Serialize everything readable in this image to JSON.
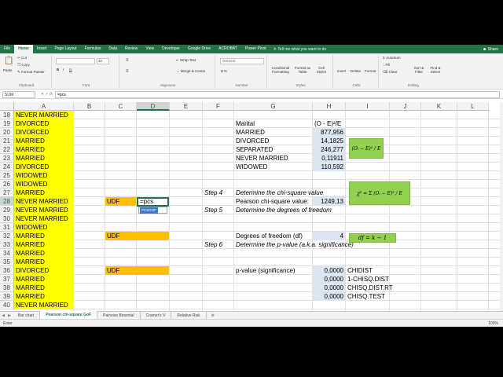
{
  "ribbon": {
    "tabs": [
      "File",
      "Home",
      "Insert",
      "Page Layout",
      "Formulas",
      "Data",
      "Review",
      "View",
      "Developer",
      "Google Drive",
      "ACROBAT",
      "Power Pivot"
    ],
    "active_tab": "Home",
    "tell_me": "Tell me what you want to do",
    "share": "Share",
    "clipboard": {
      "paste": "Paste",
      "cut": "Cut",
      "copy": "Copy",
      "format_painter": "Format Painter",
      "label": "Clipboard"
    },
    "font": {
      "label": "Font",
      "size": "10"
    },
    "alignment": {
      "wrap_text": "Wrap Text",
      "merge_center": "Merge & Center",
      "label": "Alignment"
    },
    "number": {
      "format": "General",
      "label": "Number"
    },
    "styles": {
      "conditional": "Conditional Formatting",
      "format_table": "Format as Table",
      "cell_styles": "Cell Styles",
      "label": "Styles"
    },
    "cells": {
      "insert": "Insert",
      "delete": "Delete",
      "format": "Format",
      "label": "Cells"
    },
    "editing": {
      "autosum": "AutoSum",
      "fill": "Fill",
      "clear": "Clear",
      "sort_filter": "Sort & Filter",
      "find_select": "Find & Select",
      "label": "Editing"
    }
  },
  "formula_bar": {
    "name_box": "SUM",
    "fx": "fx",
    "content": "=pcs"
  },
  "columns": [
    "A",
    "B",
    "C",
    "D",
    "E",
    "F",
    "G",
    "H",
    "I",
    "J",
    "K",
    "L"
  ],
  "selected_column": "D",
  "rows": [
    "18",
    "19",
    "20",
    "21",
    "22",
    "23",
    "24",
    "25",
    "26",
    "27",
    "28",
    "29",
    "30",
    "31",
    "32",
    "33",
    "34",
    "35",
    "36",
    "37",
    "38",
    "39",
    "40"
  ],
  "selected_row": "28",
  "col_a": [
    "NEVER MARRIED",
    "DIVORCED",
    "DIVORCED",
    "MARRIED",
    "MARRIED",
    "MARRIED",
    "DIVORCED",
    "WIDOWED",
    "WIDOWED",
    "MARRIED",
    "NEVER MARRIED",
    "NEVER MARRIED",
    "NEVER MARRIED",
    "WIDOWED",
    "MARRIED",
    "MARRIED",
    "MARRIED",
    "MARRIED",
    "DIVORCED",
    "MARRIED",
    "MARRIED",
    "MARRIED",
    "NEVER MARRIED"
  ],
  "table": {
    "header_marital": "Marital",
    "header_calc": "(O - E)²/E",
    "rows": [
      {
        "label": "MARRIED",
        "value": "877,956"
      },
      {
        "label": "DIVORCED",
        "value": "14,1825"
      },
      {
        "label": "SEPARATED",
        "value": "246,277"
      },
      {
        "label": "NEVER MARRIED",
        "value": "0,11911"
      },
      {
        "label": "WIDOWED",
        "value": "110,592"
      }
    ]
  },
  "steps": {
    "step4": "Step 4",
    "step4_text": "Determine the chi-square value",
    "step5": "Step 5",
    "step5_text": "Determine the degrees of freedom",
    "step6": "Step 6",
    "step6_text": "Determine the p-value (a.k.a. significance)"
  },
  "udf_label": "UDF",
  "editing_cell": "=pcs",
  "autocomplete": "PCSGOF",
  "pearson_label": "Pearson chi-square value:",
  "pearson_value": "1249,13",
  "df_label": "Degrees of freedom (df)",
  "df_value": "4",
  "pvalue_label": "p-value (significance)",
  "pvalues": [
    {
      "value": "0,0000",
      "func": "CHIDIST"
    },
    {
      "value": "0,0000",
      "func": "1-CHISQ.DIST"
    },
    {
      "value": "0,0000",
      "func": "CHISQ.DIST.RT"
    },
    {
      "value": "0,0000",
      "func": "CHISQ.TEST"
    }
  ],
  "formulas": {
    "f1": "(Oᵢ − E)² / E",
    "f2": "χ² = Σ (Oᵢ − E)² / E",
    "f3": "df = k − 1"
  },
  "sheet_tabs": [
    "Bar chart",
    "Pearson chi-square GoF",
    "Pairwise Binomial",
    "Cramer's V",
    "Relative Risk"
  ],
  "active_sheet": "Pearson chi-square GoF",
  "status": {
    "mode": "Enter",
    "zoom": "100%"
  },
  "colors": {
    "excel_green": "#217346",
    "yellow": "#ffff00",
    "orange": "#ffc000",
    "light_blue": "#dce6f1",
    "formula_green": "#92d050"
  }
}
